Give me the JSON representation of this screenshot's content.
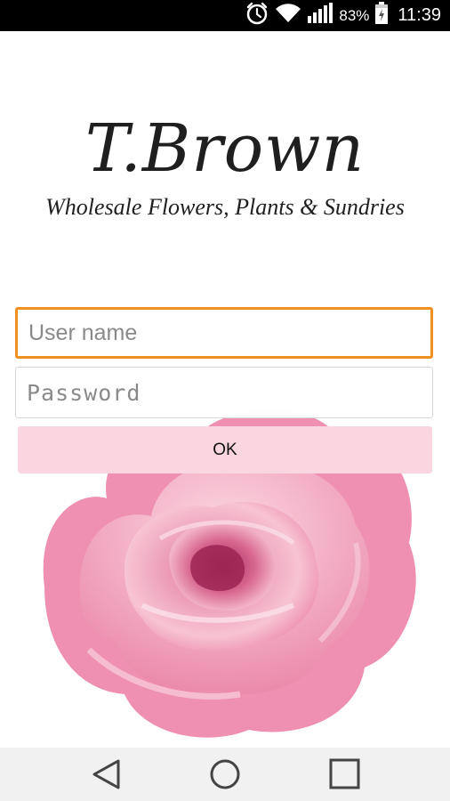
{
  "status_bar": {
    "battery_percent": "83%",
    "time": "11:39",
    "icons": [
      "alarm-icon",
      "wifi-icon",
      "signal-icon",
      "battery-charging-icon"
    ]
  },
  "logo": {
    "title": "T.Brown",
    "subtitle": "Wholesale Flowers, Plants & Sundries"
  },
  "login_form": {
    "username_placeholder": "User name",
    "username_value": "",
    "password_placeholder": "Password",
    "password_value": "",
    "ok_label": "OK"
  },
  "navigation_bar": {
    "icons": [
      "back-icon",
      "home-icon",
      "recent-apps-icon"
    ]
  },
  "colors": {
    "status_bar": "#000000",
    "focus_border": "#f0901e",
    "ok_button": "#f9d6e0",
    "rose": "#ee8fb0",
    "nav_bar": "#f1f1f1"
  }
}
